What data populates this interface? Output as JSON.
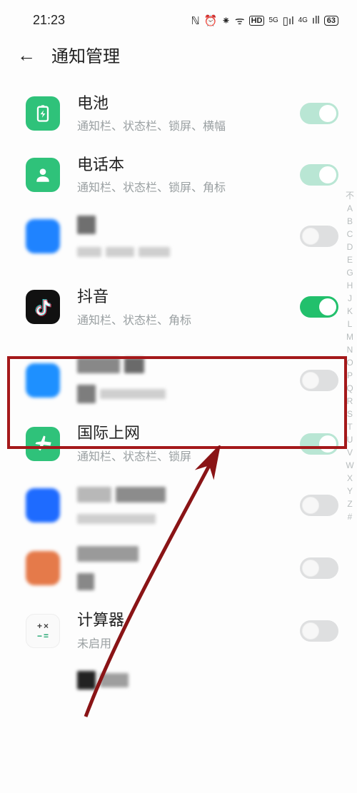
{
  "status": {
    "time": "21:23",
    "nfc": "ℕ",
    "alarm": "⏰",
    "bt": "⁕",
    "wifi": "ᯤ",
    "hd": "HD",
    "sig1": "5G",
    "sig2": "4G",
    "battery": "63"
  },
  "header": {
    "back": "←",
    "title": "通知管理"
  },
  "apps": {
    "battery": {
      "name": "电池",
      "desc": "通知栏、状态栏、锁屏、横幅"
    },
    "contacts": {
      "name": "电话本",
      "desc": "通知栏、状态栏、锁屏、角标"
    },
    "douyin": {
      "name": "抖音",
      "desc": "通知栏、状态栏、角标"
    },
    "international": {
      "name": "国际上网",
      "desc": "通知栏、状态栏、锁屏"
    },
    "calc": {
      "name": "计算器",
      "desc": "未启用"
    }
  },
  "index_letters": [
    "不",
    "A",
    "B",
    "C",
    "D",
    "E",
    "G",
    "H",
    "J",
    "K",
    "L",
    "M",
    "N",
    "O",
    "P",
    "Q",
    "R",
    "S",
    "T",
    "U",
    "V",
    "W",
    "X",
    "Y",
    "Z",
    "#"
  ],
  "icons": {
    "battery_glyph": "⚡",
    "contacts_glyph": "👤",
    "douyin_glyph": "♪",
    "plane_glyph": "✈",
    "calc_glyph": "÷×"
  }
}
